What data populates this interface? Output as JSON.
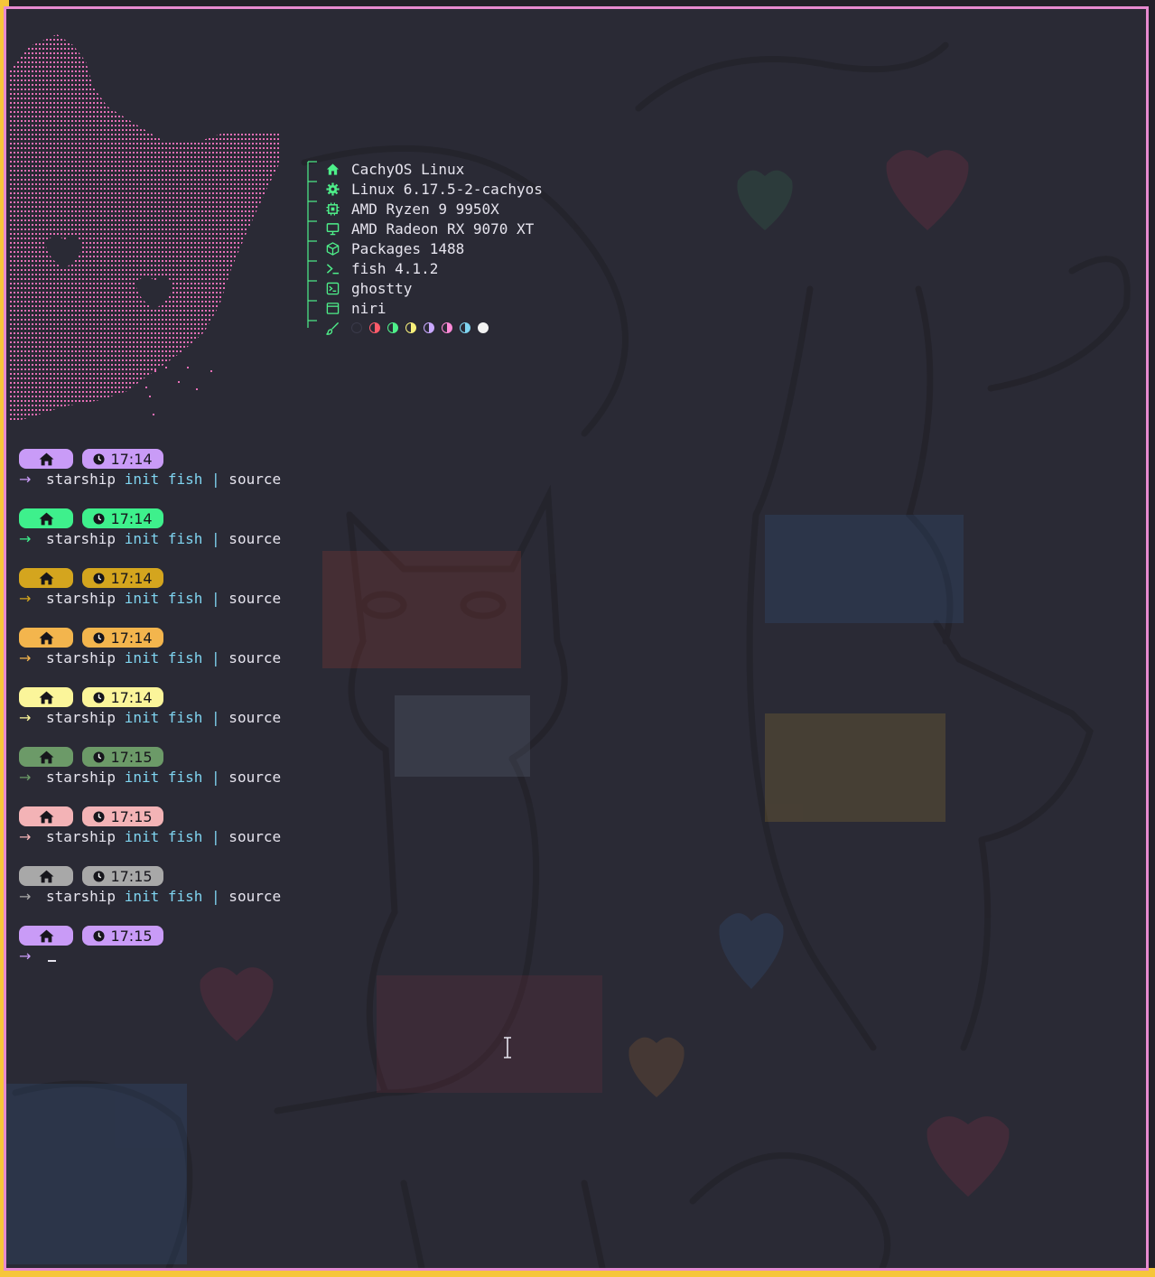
{
  "fastfetch": {
    "items": [
      {
        "icon": "home-icon",
        "text": "CachyOS Linux"
      },
      {
        "icon": "gear-icon",
        "text": "Linux 6.17.5-2-cachyos"
      },
      {
        "icon": "cpu-icon",
        "text": "AMD Ryzen 9 9950X"
      },
      {
        "icon": "monitor-icon",
        "text": "AMD Radeon RX 9070 XT"
      },
      {
        "icon": "package-icon",
        "text": "Packages 1488"
      },
      {
        "icon": "shell-icon",
        "text": "fish 4.1.2"
      },
      {
        "icon": "terminal-icon",
        "text": "ghostty"
      },
      {
        "icon": "window-icon",
        "text": "niri"
      }
    ],
    "palette_icon": "brush-icon",
    "palette": [
      "#3a3a4a",
      "#ff5b6a",
      "#4ef08a",
      "#f6ef7a",
      "#c9a8ff",
      "#ff8ad8",
      "#7fd4f0",
      "#f2f2f2"
    ]
  },
  "prompts": [
    {
      "color": "#c99bf7",
      "time": "17:14",
      "command": [
        "starship",
        "init",
        "fish",
        "|",
        "source"
      ]
    },
    {
      "color": "#3ef08c",
      "time": "17:14",
      "command": [
        "starship",
        "init",
        "fish",
        "|",
        "source"
      ]
    },
    {
      "color": "#d4a51e",
      "time": "17:14",
      "command": [
        "starship",
        "init",
        "fish",
        "|",
        "source"
      ]
    },
    {
      "color": "#f3b54d",
      "time": "17:14",
      "command": [
        "starship",
        "init",
        "fish",
        "|",
        "source"
      ]
    },
    {
      "color": "#fbf59a",
      "time": "17:14",
      "command": [
        "starship",
        "init",
        "fish",
        "|",
        "source"
      ]
    },
    {
      "color": "#6c9a68",
      "time": "17:15",
      "command": [
        "starship",
        "init",
        "fish",
        "|",
        "source"
      ]
    },
    {
      "color": "#f3b3b6",
      "time": "17:15",
      "command": [
        "starship",
        "init",
        "fish",
        "|",
        "source"
      ]
    },
    {
      "color": "#a8a8a8",
      "time": "17:15",
      "command": [
        "starship",
        "init",
        "fish",
        "|",
        "source"
      ]
    },
    {
      "color": "#c99bf7",
      "time": "17:15",
      "command": []
    }
  ],
  "colors": {
    "border": "#e78ad0",
    "accent_green": "#4ef08a",
    "text": "#e6e4ee",
    "keyword": "#7fd4f0"
  }
}
